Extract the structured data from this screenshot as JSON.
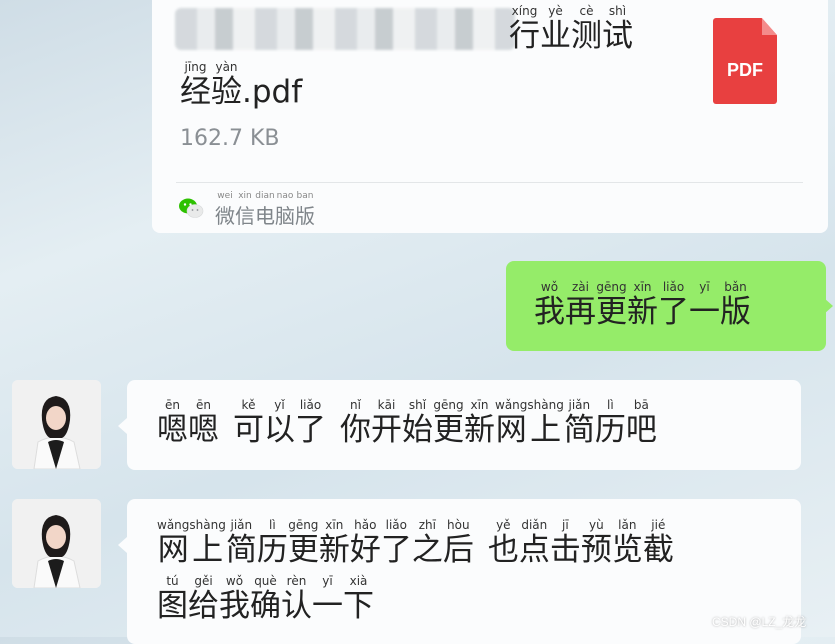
{
  "file_message": {
    "name_line1": [
      {
        "py": "xíng",
        "hz": "行"
      },
      {
        "py": "yè",
        "hz": "业"
      },
      {
        "py": "cè",
        "hz": "测"
      },
      {
        "py": "shì",
        "hz": "试"
      }
    ],
    "name_line2": [
      {
        "py": "jīng",
        "hz": "经"
      },
      {
        "py": "yàn",
        "hz": "验"
      }
    ],
    "name_ext": ".pdf",
    "size": "162.7 KB",
    "file_icon_label": "PDF",
    "file_icon_color": "#e84040",
    "source": [
      {
        "py": "wei",
        "hz": "微"
      },
      {
        "py": "xin",
        "hz": "信"
      },
      {
        "py": "dian",
        "hz": "电"
      },
      {
        "py": "nao",
        "hz": "脑"
      },
      {
        "py": "ban",
        "hz": "版"
      }
    ]
  },
  "outgoing_message": [
    {
      "py": "wǒ",
      "hz": "我"
    },
    {
      "py": "zài",
      "hz": "再"
    },
    {
      "py": "gēng",
      "hz": "更"
    },
    {
      "py": "xīn",
      "hz": "新"
    },
    {
      "py": "liǎo",
      "hz": "了"
    },
    {
      "py": "yī",
      "hz": "一"
    },
    {
      "py": "bǎn",
      "hz": "版"
    }
  ],
  "incoming_message_1": [
    {
      "py": "ēn",
      "hz": "嗯"
    },
    {
      "py": "ēn",
      "hz": "嗯"
    },
    {
      "gap": true
    },
    {
      "py": "kě",
      "hz": "可"
    },
    {
      "py": "yǐ",
      "hz": "以"
    },
    {
      "py": "liǎo",
      "hz": "了"
    },
    {
      "gap": true
    },
    {
      "py": "nǐ",
      "hz": "你"
    },
    {
      "py": "kāi",
      "hz": "开"
    },
    {
      "py": "shǐ",
      "hz": "始"
    },
    {
      "py": "gēng",
      "hz": "更"
    },
    {
      "py": "xīn",
      "hz": "新"
    },
    {
      "py": "wǎng",
      "hz": "网"
    },
    {
      "py": "shàng",
      "hz": "上"
    },
    {
      "py": "jiǎn",
      "hz": "简"
    },
    {
      "py": "lì",
      "hz": "历"
    },
    {
      "py": "bā",
      "hz": "吧"
    }
  ],
  "incoming_message_2_line1": [
    {
      "py": "wǎng",
      "hz": "网"
    },
    {
      "py": "shàng",
      "hz": "上"
    },
    {
      "py": "jiǎn",
      "hz": "简"
    },
    {
      "py": "lì",
      "hz": "历"
    },
    {
      "py": "gēng",
      "hz": "更"
    },
    {
      "py": "xīn",
      "hz": "新"
    },
    {
      "py": "hǎo",
      "hz": "好"
    },
    {
      "py": "liǎo",
      "hz": "了"
    },
    {
      "py": "zhī",
      "hz": "之"
    },
    {
      "py": "hòu",
      "hz": "后"
    },
    {
      "gap": true
    },
    {
      "py": "yě",
      "hz": "也"
    },
    {
      "py": "diǎn",
      "hz": "点"
    },
    {
      "py": "jī",
      "hz": "击"
    },
    {
      "py": "yù",
      "hz": "预"
    },
    {
      "py": "lǎn",
      "hz": "览"
    },
    {
      "py": "jié",
      "hz": "截"
    }
  ],
  "incoming_message_2_line2": [
    {
      "py": "tú",
      "hz": "图"
    },
    {
      "py": "gěi",
      "hz": "给"
    },
    {
      "py": "wǒ",
      "hz": "我"
    },
    {
      "py": "què",
      "hz": "确"
    },
    {
      "py": "rèn",
      "hz": "认"
    },
    {
      "py": "yī",
      "hz": "一"
    },
    {
      "py": "xià",
      "hz": "下"
    }
  ],
  "watermark": "CSDN @LZ_龙龙",
  "colors": {
    "outgoing_bubble": "#95ec69",
    "incoming_bubble": "#fbfcfd",
    "wechat_green": "#2dc100"
  }
}
